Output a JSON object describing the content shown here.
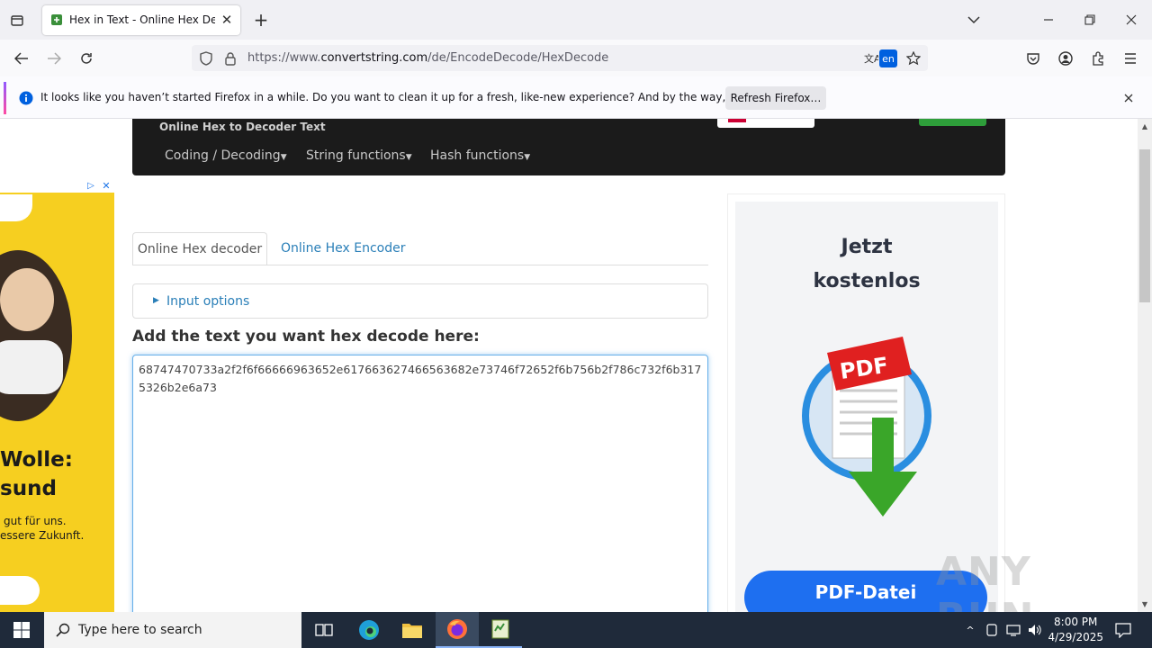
{
  "browser": {
    "tab_title": "Hex in Text - Online Hex Decod",
    "url_prefix": "https://www.",
    "url_domain": "convertstring.com",
    "url_path": "/de/EncodeDecode/HexDecode",
    "translate_lang": "en"
  },
  "notification": {
    "message": "It looks like you haven’t started Firefox in a while. Do you want to clean it up for a fresh, like-new experience? And by the way, welcome back!",
    "button": "Refresh Firefox…"
  },
  "site": {
    "subtitle": "Online Hex to Decoder Text",
    "menu": [
      "Coding / Decoding",
      "String functions",
      "Hash functions"
    ]
  },
  "tabs": {
    "active": "Online Hex decoder",
    "other": "Online Hex Encoder"
  },
  "input_options": "Input options",
  "heading": "Add the text you want hex decode here:",
  "textarea_value": "68747470733a2f2f6f66666963652e617663627466563682e73746f72652f6b756b2f786c732f6b3175326b2e6a73",
  "ad_left": {
    "line1": "Wolle:",
    "line2": "sund",
    "line3": "gut für uns.",
    "line4": "essere Zukunft."
  },
  "ad_right": {
    "line1": "Jetzt",
    "line2": "kostenlos",
    "pdf_label": "PDF",
    "button": "PDF-Datei"
  },
  "watermark": "ANY RUN",
  "taskbar": {
    "search_placeholder": "Type here to search",
    "time": "8:00 PM",
    "date": "4/29/2025"
  },
  "colors": {
    "accent_link": "#2a7fb8",
    "nav_bg": "#1b1b1b",
    "ad_yellow": "#f6cf20",
    "pdf_blue": "#1e6ff0"
  }
}
